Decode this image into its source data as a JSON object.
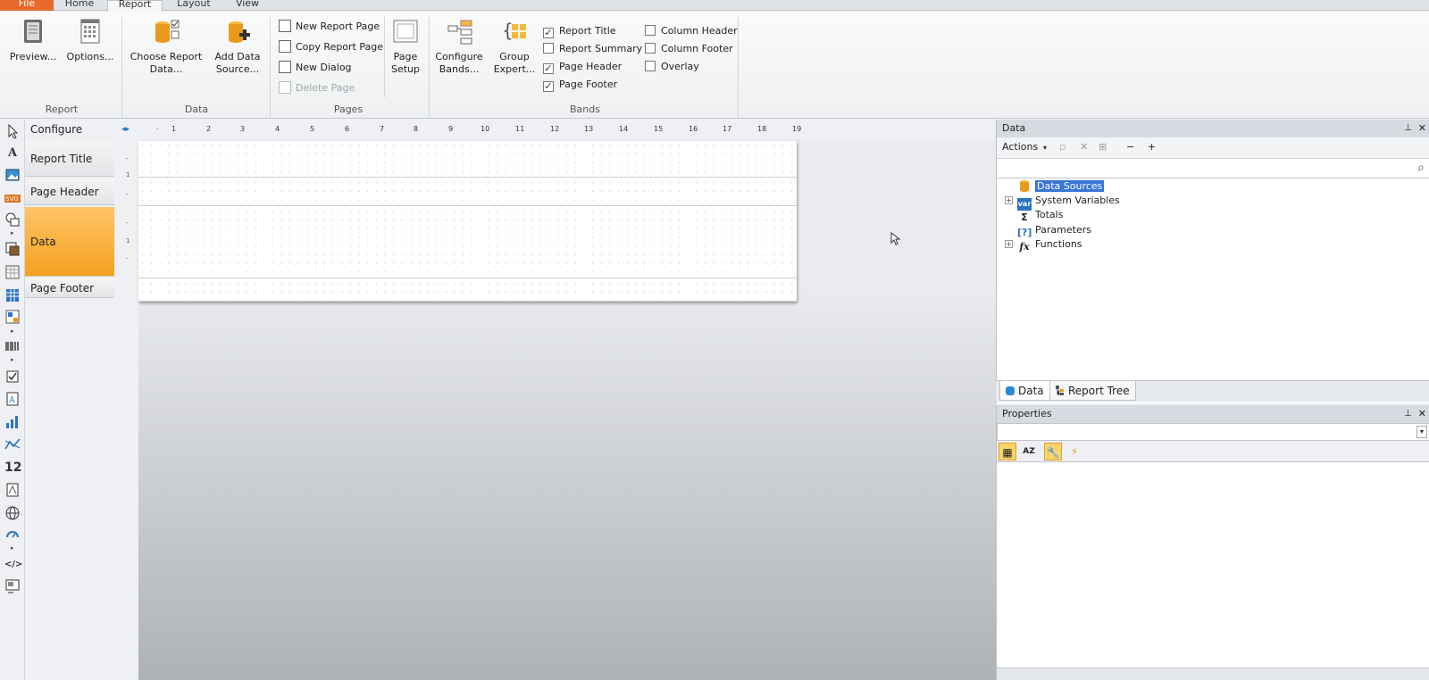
{
  "tabs": [
    "File",
    "Home",
    "Report",
    "Layout",
    "View"
  ],
  "ribbon": {
    "report_group": {
      "label": "Report",
      "preview": "Preview...",
      "options": "Options..."
    },
    "data_group": {
      "label": "Data",
      "choose_line1": "Choose Report",
      "choose_line2": "Data...",
      "add_line1": "Add Data",
      "add_line2": "Source..."
    },
    "pages_group": {
      "label": "Pages",
      "new_page": "New Report Page",
      "copy_page": "Copy Report Page",
      "new_dialog": "New Dialog",
      "delete_page": "Delete Page",
      "setup_line1": "Page",
      "setup_line2": "Setup"
    },
    "bands_group": {
      "label": "Bands",
      "configure_line1": "Configure",
      "configure_line2": "Bands...",
      "group_line1": "Group",
      "group_line2": "Expert...",
      "checks": [
        {
          "label": "Report Title",
          "checked": true
        },
        {
          "label": "Report Summary",
          "checked": false
        },
        {
          "label": "Page Header",
          "checked": true
        },
        {
          "label": "Page Footer",
          "checked": true
        },
        {
          "label": "Column Header",
          "checked": false
        },
        {
          "label": "Column Footer",
          "checked": false
        },
        {
          "label": "Overlay",
          "checked": false
        }
      ]
    }
  },
  "bandpanel": {
    "configure": "Configure",
    "bands": [
      "Report Title",
      "Page Header",
      "Data",
      "Page Footer"
    ]
  },
  "ruler_ticks": [
    "1",
    "2",
    "3",
    "4",
    "5",
    "6",
    "7",
    "8",
    "9",
    "10",
    "11",
    "12",
    "13",
    "14",
    "15",
    "16",
    "17",
    "18",
    "19"
  ],
  "toolbox": [
    "pointer-icon",
    "text-icon",
    "picture-icon",
    "svg-icon",
    "shape-icon",
    "subreport-icon",
    "table-icon",
    "matrix-icon",
    "cellular-text-icon",
    "barcode-icon",
    "checkbox-icon",
    "rich-text-icon",
    "chart-icon",
    "sparkline-icon",
    "digital-signature-icon",
    "zip-code-icon",
    "map-icon",
    "gauge-icon",
    "html-icon",
    "dialog-icon"
  ],
  "data_panel": {
    "title": "Data",
    "actions": "Actions",
    "tree": [
      "Data Sources",
      "System Variables",
      "Totals",
      "Parameters",
      "Functions"
    ],
    "tabs": [
      "Data",
      "Report Tree"
    ]
  },
  "properties_panel": {
    "title": "Properties"
  },
  "colors": {
    "file_tab": "#e8692c",
    "data_band": "#f4a11e",
    "selection": "#3875d7"
  }
}
